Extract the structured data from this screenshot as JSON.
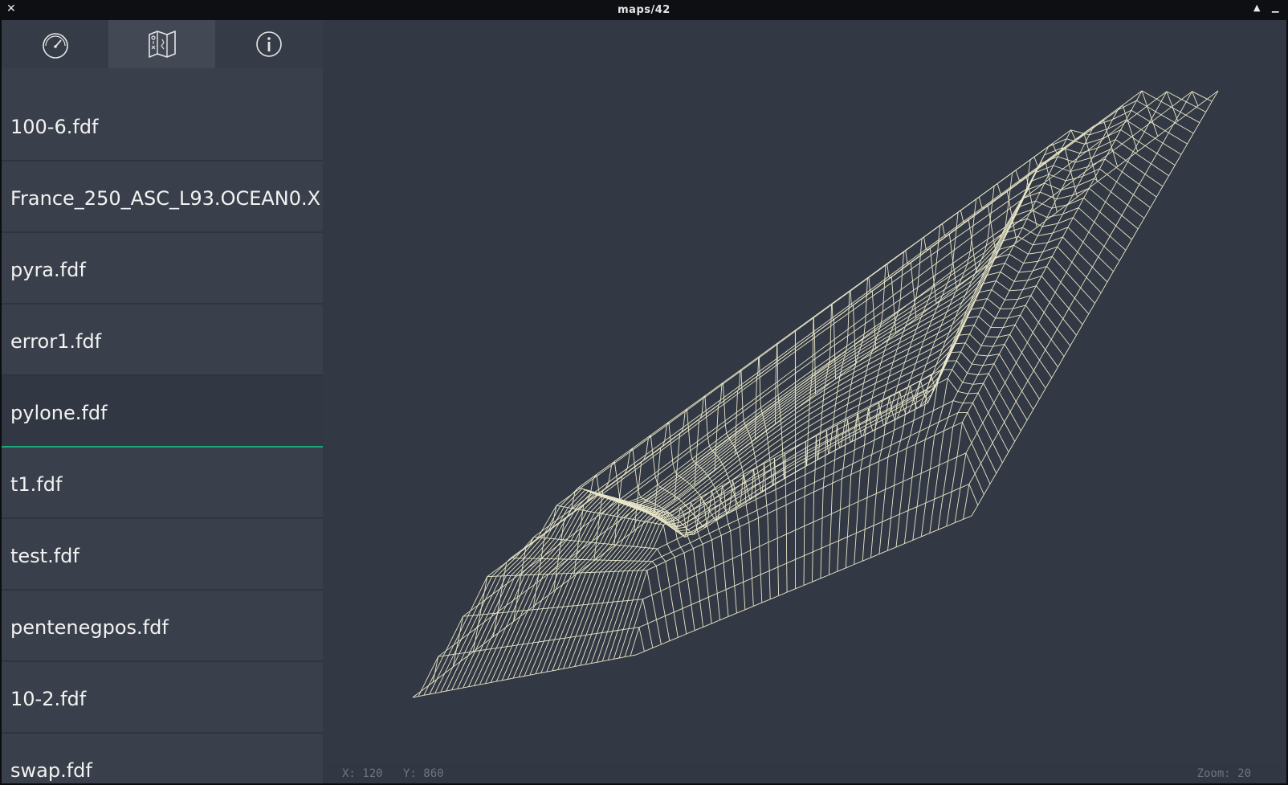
{
  "window": {
    "title": "maps/42",
    "close_glyph": "✕",
    "maximize_glyph": "▲",
    "minimize_glyph": "▁"
  },
  "tabs": [
    {
      "icon": "speedometer-icon"
    },
    {
      "icon": "map-icon"
    },
    {
      "icon": "info-icon"
    }
  ],
  "files": [
    "100-6.fdf",
    "France_250_ASC_L93.OCEAN0.X",
    "pyra.fdf",
    "error1.fdf",
    "pylone.fdf",
    "t1.fdf",
    "test.fdf",
    "pentenegpos.fdf",
    "10-2.fdf",
    "swap.fdf"
  ],
  "selected_file": "pylone.fdf",
  "colors": {
    "wireframe": "#e8e6c8",
    "selection_accent": "#18a979",
    "background": "#333944"
  },
  "status": {
    "x_label": "X: 120",
    "y_label": "Y: 860",
    "zoom_label": "Zoom: 20"
  }
}
